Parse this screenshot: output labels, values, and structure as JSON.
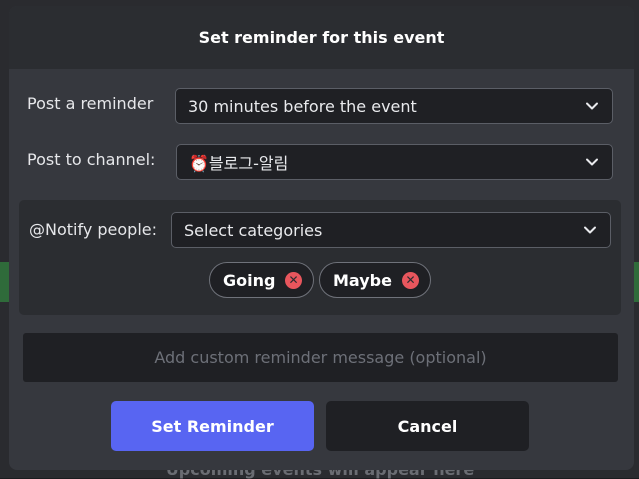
{
  "background": {
    "hint_text": "Upcoming events will appear here"
  },
  "modal": {
    "title": "Set reminder for this event"
  },
  "reminder": {
    "label": "Post a reminder",
    "selected": "30 minutes before the event"
  },
  "channel": {
    "label": "Post to channel:",
    "selected": "⏰블로그-알림"
  },
  "notify": {
    "label": "@Notify people:",
    "placeholder": "Select categories",
    "tags": [
      {
        "label": "Going"
      },
      {
        "label": "Maybe"
      }
    ]
  },
  "custom_message": {
    "placeholder": "Add custom reminder message (optional)"
  },
  "buttons": {
    "set_label": "Set Reminder",
    "cancel_label": "Cancel"
  },
  "colors": {
    "primary": "#5865f2",
    "remove_icon": "#e8565d"
  }
}
